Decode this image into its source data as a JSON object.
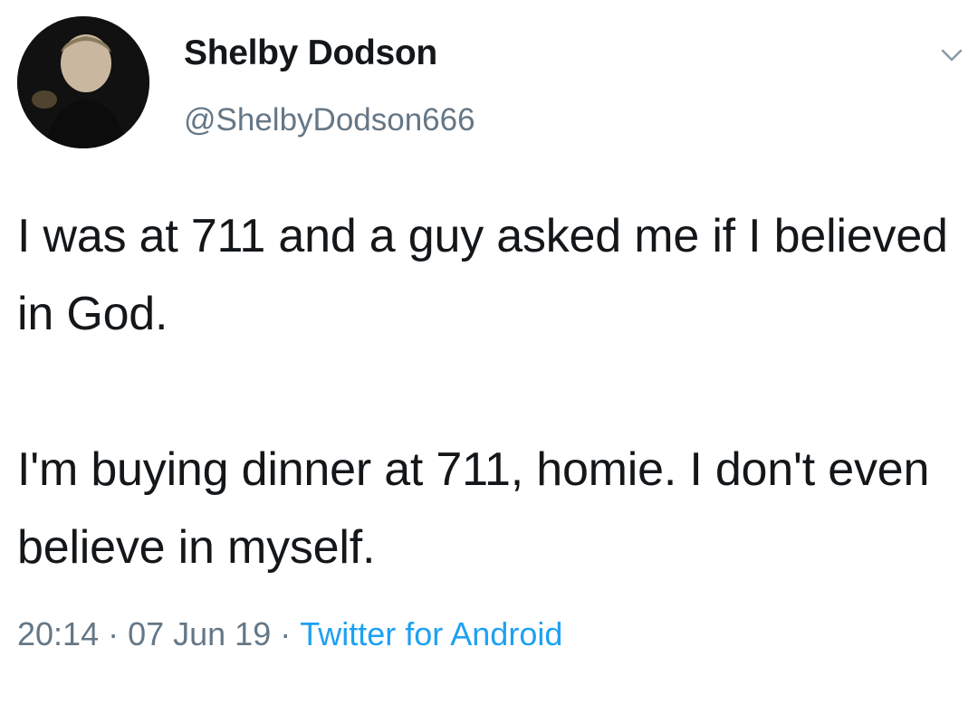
{
  "author": {
    "display_name": "Shelby Dodson",
    "handle": "@ShelbyDodson666"
  },
  "tweet": {
    "paragraphs": [
      "I was at 711 and a guy asked me if I believed in God.",
      "I'm buying dinner at 711, homie. I don't even believe in myself."
    ],
    "time": "20:14",
    "date": "07 Jun 19",
    "separator": "·",
    "source": "Twitter for Android"
  },
  "icons": {
    "menu": "chevron-down-icon",
    "avatar": "avatar"
  },
  "colors": {
    "text": "#14171a",
    "secondary": "#657786",
    "link": "#1da1f2",
    "background": "#ffffff"
  }
}
